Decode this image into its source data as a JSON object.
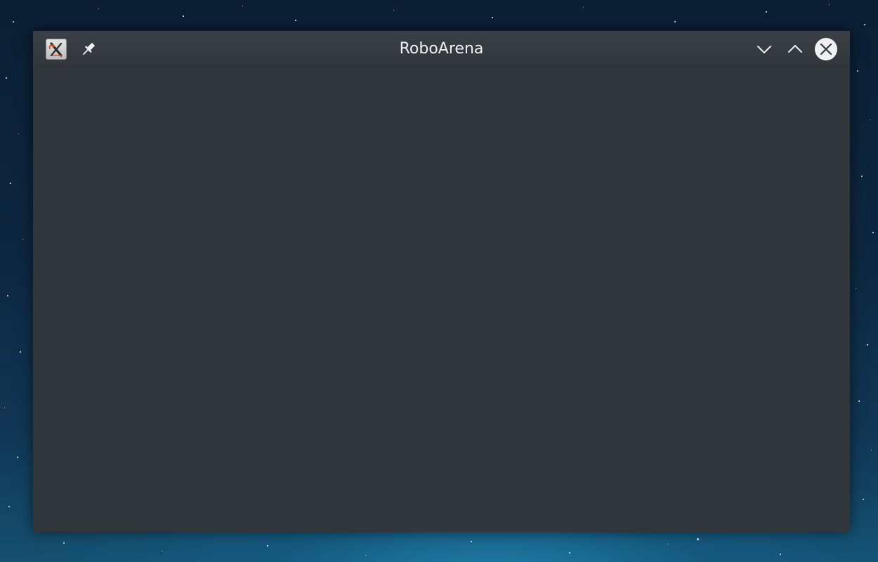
{
  "window": {
    "title": "RoboArena",
    "app_icon": "xming-x-icon",
    "pin_icon": "pin-icon",
    "minimize_icon": "chevron-down-icon",
    "maximize_icon": "chevron-up-icon",
    "close_icon": "close-icon"
  },
  "colors": {
    "window_bg": "#31363b",
    "titlebar_text": "#eff0f1",
    "close_button_bg": "#eff0f1",
    "close_button_glyph": "#31363b"
  }
}
